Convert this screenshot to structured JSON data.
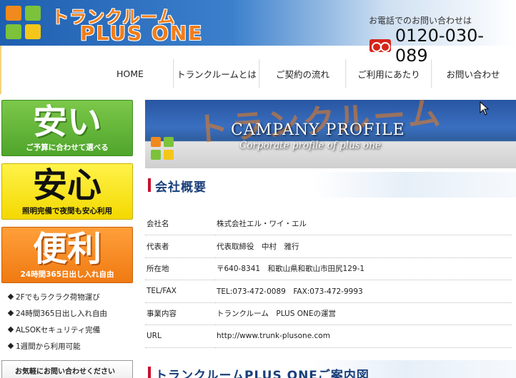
{
  "header": {
    "logo_top": "トランクルーム",
    "logo_bottom": "PLUS ONE",
    "phone_label": "お電話でのお問い合わせは",
    "phone_number": "0120-030-089"
  },
  "nav": [
    {
      "label": "HOME"
    },
    {
      "label": "トランクルームとは"
    },
    {
      "label": "ご契約の流れ"
    },
    {
      "label": "ご利用にあたり"
    },
    {
      "label": "お問い合わせ"
    }
  ],
  "features": [
    {
      "big": "安い",
      "sub": "ご予算に合わせて選べる"
    },
    {
      "big": "安心",
      "sub": "照明完備で夜間も安心利用"
    },
    {
      "big": "便利",
      "sub": "24時間365日出し入れ自由"
    }
  ],
  "bullets": [
    "2Fでもラクラク荷物運び",
    "24時間365日出し入れ自由",
    "ALSOKセキュリティ完備",
    "1週間から利用可能"
  ],
  "contact_box": "お気軽にお問い合わせください",
  "banner": {
    "title": "CAMPANY PROFILE",
    "subtitle": "Corporate profile of plus one"
  },
  "section1": {
    "title": "会社概要"
  },
  "company": [
    {
      "key": "会社名",
      "value": "株式会社エル・ワイ・エル"
    },
    {
      "key": "代表者",
      "value": "代表取締役　中村　雅行"
    },
    {
      "key": "所在地",
      "value": "〒640-8341　和歌山県和歌山市田尻129-1"
    },
    {
      "key": "TEL/FAX",
      "value": "TEL:073-472-0089　FAX:073-472-9993"
    },
    {
      "key": "事業内容",
      "value": "トランクルーム　PLUS ONEの運営"
    },
    {
      "key": "URL",
      "value": "http://www.trunk-plusone.com"
    }
  ],
  "section2": {
    "title": "トランクルームPLUS ONEご案内図"
  },
  "colors": {
    "brand_orange": "#f07e1b",
    "header_blue": "#1f5fb0",
    "feature_green": "#5bb035",
    "feature_yellow": "#f7e21a",
    "feature_orange": "#f5841f",
    "heading_navy": "#1a3f7a",
    "heading_bar_red": "#c8102e"
  }
}
